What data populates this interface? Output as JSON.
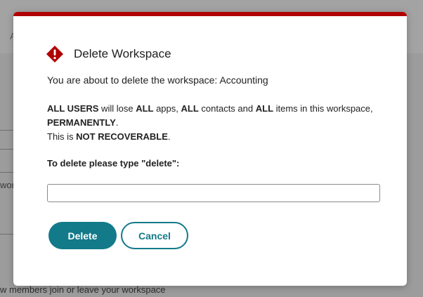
{
  "background": {
    "topbar_text": "A",
    "side_text": "wor",
    "bottom_text": "w members join or leave your workspace"
  },
  "dialog": {
    "title": "Delete Workspace",
    "icon": "warning-diamond-icon",
    "accent_color": "#b00000",
    "intro": "You are about to delete the workspace: Accounting",
    "warning": {
      "p1_bold": "ALL USERS",
      "p2": " will lose ",
      "p3_bold": "ALL",
      "p4": " apps, ",
      "p5_bold": "ALL",
      "p6": " contacts and ",
      "p7_bold": "ALL",
      "p8": " items in this workspace, ",
      "p9_bold": "PERMANENTLY",
      "p10": ".",
      "line2_text": "This is ",
      "line2_bold": "NOT RECOVERABLE",
      "line2_end": "."
    },
    "confirm_label": "To delete please type \"delete\":",
    "confirm_value": "",
    "confirm_placeholder": "",
    "delete_label": "Delete",
    "cancel_label": "Cancel",
    "button_color": "#137a89"
  }
}
